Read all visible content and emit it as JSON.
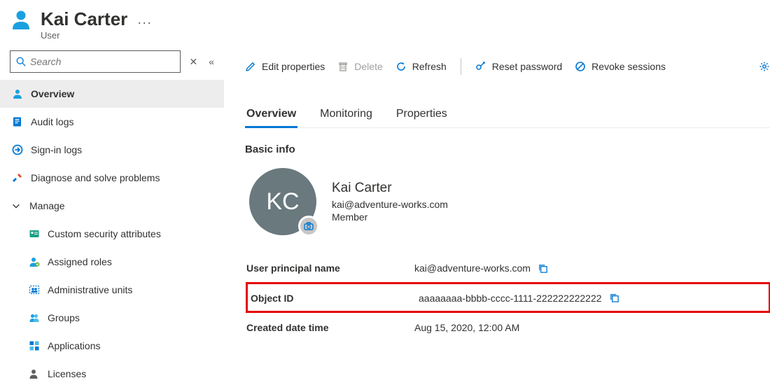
{
  "header": {
    "title": "Kai Carter",
    "subtype": "User"
  },
  "sidebar": {
    "search_placeholder": "Search",
    "items": [
      {
        "key": "overview",
        "label": "Overview"
      },
      {
        "key": "audit-logs",
        "label": "Audit logs"
      },
      {
        "key": "sign-in-logs",
        "label": "Sign-in logs"
      },
      {
        "key": "diagnose",
        "label": "Diagnose and solve problems"
      }
    ],
    "manage_label": "Manage",
    "manage_items": [
      {
        "key": "custom-security",
        "label": "Custom security attributes"
      },
      {
        "key": "assigned-roles",
        "label": "Assigned roles"
      },
      {
        "key": "admin-units",
        "label": "Administrative units"
      },
      {
        "key": "groups",
        "label": "Groups"
      },
      {
        "key": "applications",
        "label": "Applications"
      },
      {
        "key": "licenses",
        "label": "Licenses"
      }
    ]
  },
  "toolbar": {
    "edit": "Edit properties",
    "delete": "Delete",
    "refresh": "Refresh",
    "reset_password": "Reset password",
    "revoke_sessions": "Revoke sessions"
  },
  "tabs": [
    {
      "key": "overview",
      "label": "Overview",
      "active": true
    },
    {
      "key": "monitoring",
      "label": "Monitoring",
      "active": false
    },
    {
      "key": "properties",
      "label": "Properties",
      "active": false
    }
  ],
  "section_title": "Basic info",
  "profile": {
    "initials": "KC",
    "display_name": "Kai Carter",
    "email": "kai@adventure-works.com",
    "member_type": "Member"
  },
  "details": {
    "upn_label": "User principal name",
    "upn_value": "kai@adventure-works.com",
    "object_id_label": "Object ID",
    "object_id_value": "aaaaaaaa-bbbb-cccc-1111-222222222222",
    "created_label": "Created date time",
    "created_value": "Aug 15, 2020, 12:00 AM"
  }
}
